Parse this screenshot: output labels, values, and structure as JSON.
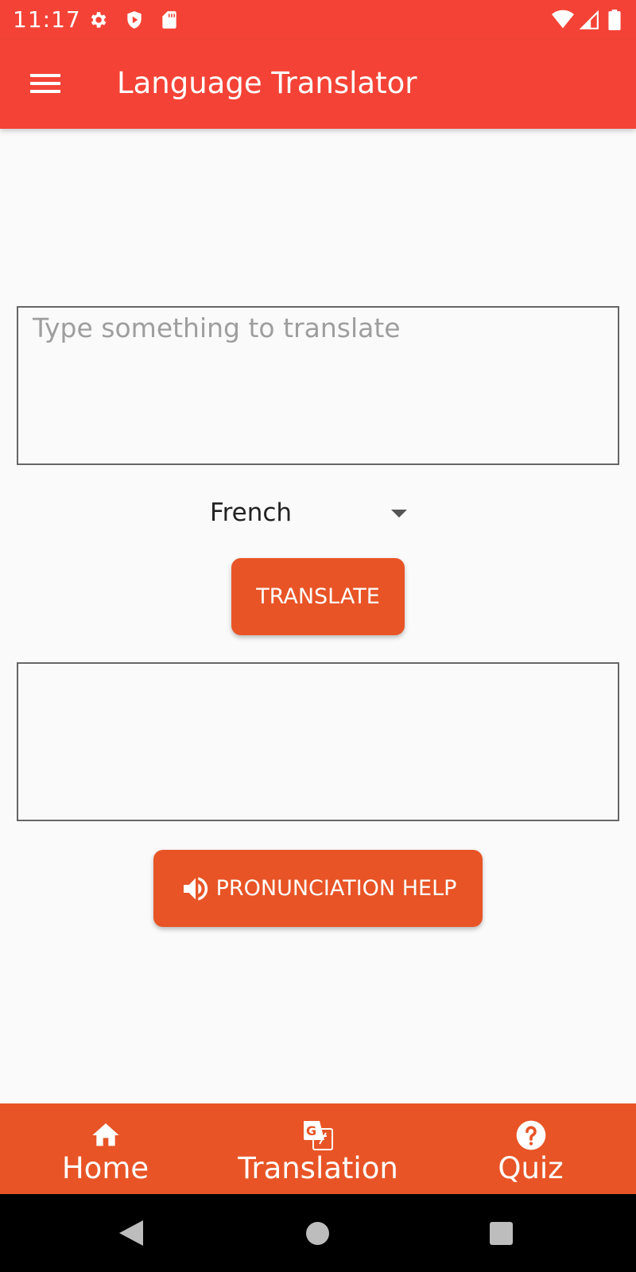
{
  "status_bar": {
    "time": "11:17",
    "left_icons": [
      "gear-icon",
      "shield-icon",
      "sd-card-icon"
    ],
    "right_icons": [
      "wifi-icon",
      "signal-icon",
      "battery-icon"
    ]
  },
  "app_bar": {
    "title": "Language Translator",
    "menu_icon": "hamburger-menu-icon"
  },
  "input": {
    "placeholder": "Type something to translate",
    "value": ""
  },
  "language_select": {
    "selected": "French"
  },
  "translate_button": {
    "label": "TRANSLATE"
  },
  "output": {
    "value": ""
  },
  "pronunciation_button": {
    "label": "PRONUNCIATION HELP",
    "icon": "volume-icon"
  },
  "bottom_nav": {
    "items": [
      {
        "label": "Home",
        "icon": "home-icon"
      },
      {
        "label": "Translation",
        "icon": "translate-icon"
      },
      {
        "label": "Quiz",
        "icon": "help-circle-icon"
      }
    ]
  },
  "colors": {
    "status_bar": "#f44336",
    "app_bar": "#f44336",
    "accent": "#e85426",
    "background": "#fafafa"
  }
}
